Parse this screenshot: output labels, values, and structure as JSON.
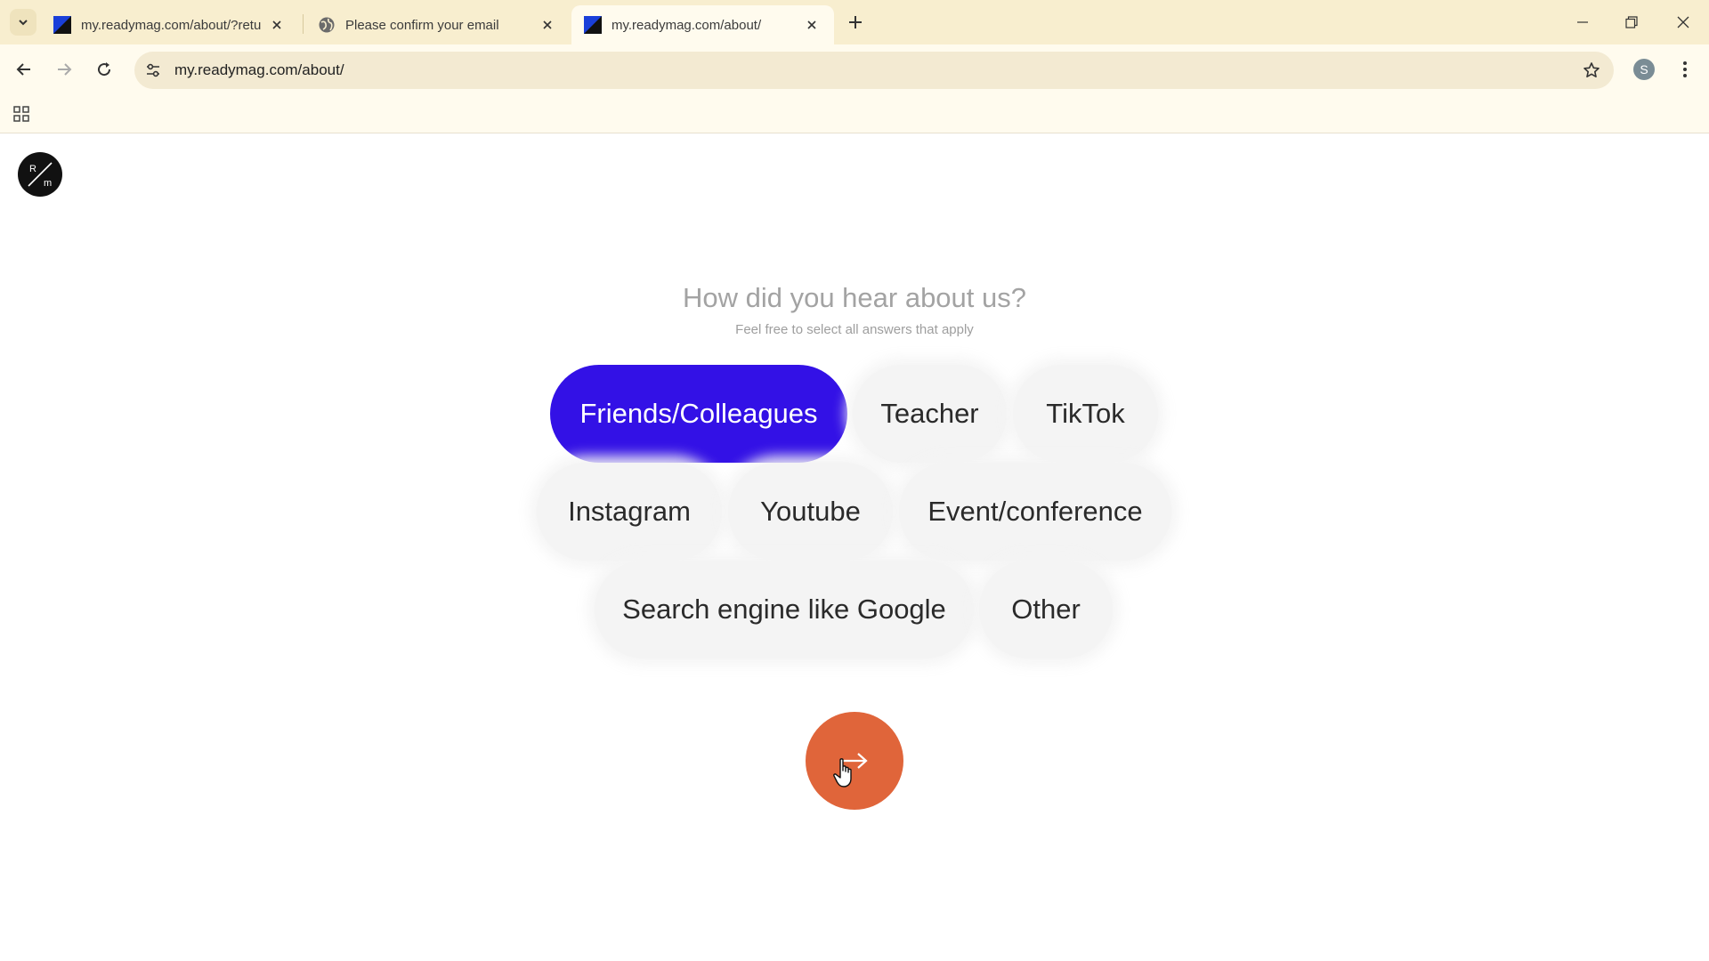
{
  "browser": {
    "tabs": [
      {
        "title": "my.readymag.com/about/?retu",
        "active": false,
        "favicon": "readymag-favicon"
      },
      {
        "title": "Please confirm your email",
        "active": false,
        "favicon": "globe-icon"
      },
      {
        "title": "my.readymag.com/about/",
        "active": true,
        "favicon": "readymag-favicon"
      }
    ],
    "url": "my.readymag.com/about/",
    "profile_initial": "S",
    "colors": {
      "frame": "#f8eecf",
      "toolbar": "#fffbee",
      "omnibox": "#f3ead2"
    }
  },
  "page": {
    "logo": {
      "top": "R",
      "bottom": "m"
    },
    "heading": "How did you hear about us?",
    "subheading": "Feel free to select all answers that apply",
    "options": [
      {
        "label": "Friends/Colleagues",
        "selected": true
      },
      {
        "label": "Teacher",
        "selected": false
      },
      {
        "label": "TikTok",
        "selected": false
      },
      {
        "label": "Instagram",
        "selected": false
      },
      {
        "label": "Youtube",
        "selected": false
      },
      {
        "label": "Event/conference",
        "selected": false
      },
      {
        "label": "Search engine like Google",
        "selected": false
      },
      {
        "label": "Other",
        "selected": false
      }
    ],
    "next_button_icon": "arrow-right-icon",
    "colors": {
      "selected": "#3311e6",
      "option_bg": "#f4f4f4",
      "next_button": "#e0653a",
      "heading": "#a3a3a3"
    }
  }
}
